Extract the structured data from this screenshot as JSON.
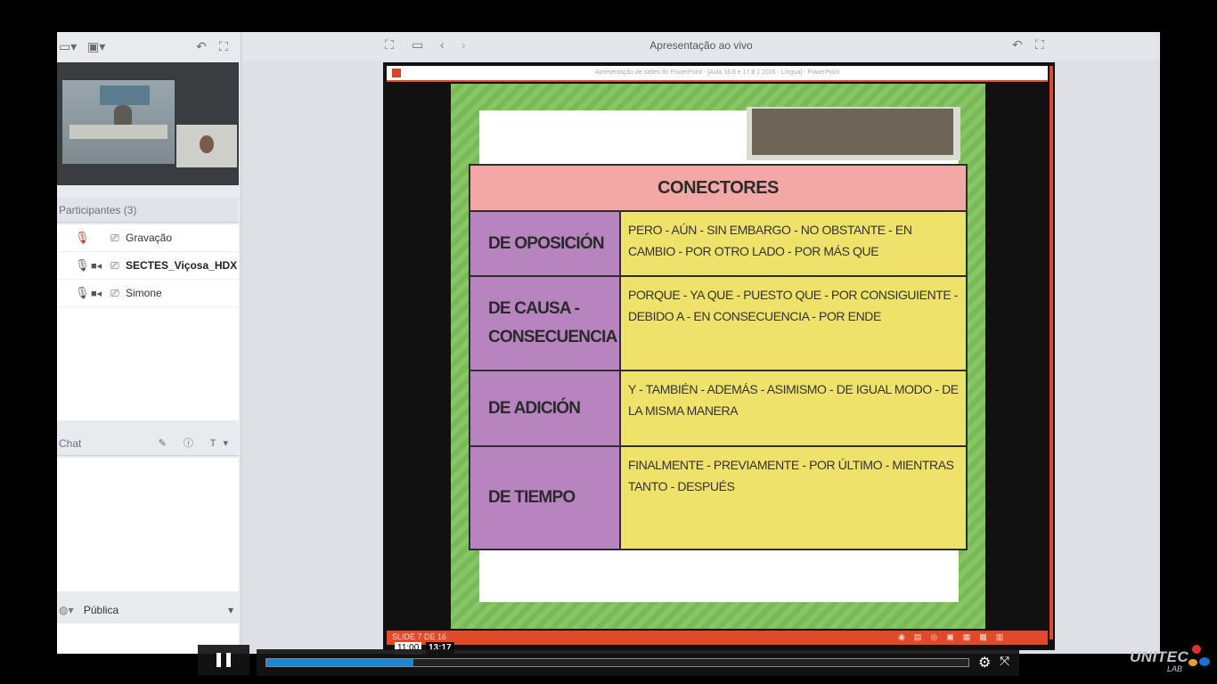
{
  "main": {
    "title": "Apresentação ao vivo",
    "ppt_window_title": "Apresentação de slides do PowerPoint - [Aula 16.8 e 17.8 1 2016 - Língua] - PowerPoint"
  },
  "participants": {
    "header": "Participantes (3)",
    "list": [
      {
        "name": "Gravação"
      },
      {
        "name": "SECTES_Viçosa_HDX"
      },
      {
        "name": "Simone"
      }
    ]
  },
  "chat": {
    "header": "Chat",
    "audience": "Pública"
  },
  "slide": {
    "table_title": "CONECTORES",
    "rows": [
      {
        "category": "DE OPOSICIÓN",
        "connectors": "PERO - AÚN - SIN EMBARGO - NO OBSTANTE - EN CAMBIO - POR OTRO LADO - POR MÁS QUE"
      },
      {
        "category": "DE CAUSA - CONSECUENCIA",
        "connectors": "PORQUE - YA QUE - PUESTO QUE - POR CONSIGUIENTE - DEBIDO A - EN CONSECUENCIA - POR ENDE"
      },
      {
        "category": "DE ADICIÓN",
        "connectors": "Y - TAMBIÉN - ADEMÁS - ASIMISMO - DE IGUAL MODO - DE LA MISMA MANERA"
      },
      {
        "category": "DE TIEMPO",
        "connectors": "FINALMENTE - PREVIAMENTE - POR ÚLTIMO - MIENTRAS TANTO - DESPUÉS"
      }
    ],
    "status_left": "SLIDE 7 DE 16"
  },
  "player": {
    "hover_time": "11:00",
    "total_time": "13:17",
    "progress_fraction": 0.21
  },
  "watermark": {
    "brand": "UNITEC",
    "sub": "LAB"
  },
  "colors": {
    "header_pink": "#f3a8a6",
    "category_purple": "#b884c0",
    "value_yellow": "#efe26a",
    "slide_green": "#7fc25a",
    "ppt_orange": "#e04a2a",
    "progress_blue": "#1a87d6"
  }
}
